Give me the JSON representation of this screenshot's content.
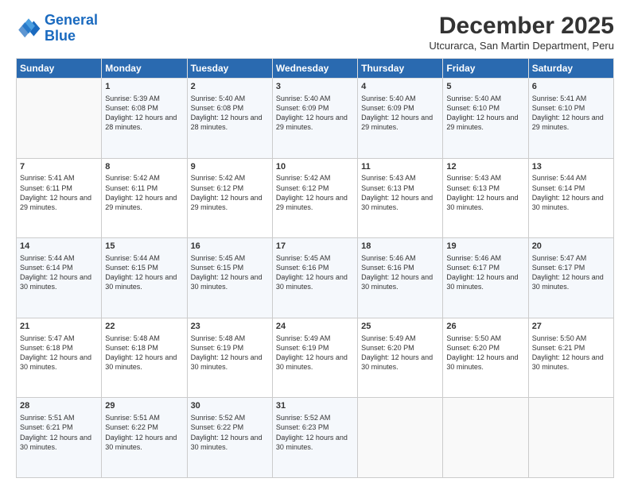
{
  "logo": {
    "line1": "General",
    "line2": "Blue"
  },
  "title": "December 2025",
  "location": "Utcurarca, San Martin Department, Peru",
  "days_of_week": [
    "Sunday",
    "Monday",
    "Tuesday",
    "Wednesday",
    "Thursday",
    "Friday",
    "Saturday"
  ],
  "weeks": [
    [
      {
        "num": "",
        "info": ""
      },
      {
        "num": "1",
        "info": "Sunrise: 5:39 AM\nSunset: 6:08 PM\nDaylight: 12 hours\nand 28 minutes."
      },
      {
        "num": "2",
        "info": "Sunrise: 5:40 AM\nSunset: 6:08 PM\nDaylight: 12 hours\nand 28 minutes."
      },
      {
        "num": "3",
        "info": "Sunrise: 5:40 AM\nSunset: 6:09 PM\nDaylight: 12 hours\nand 29 minutes."
      },
      {
        "num": "4",
        "info": "Sunrise: 5:40 AM\nSunset: 6:09 PM\nDaylight: 12 hours\nand 29 minutes."
      },
      {
        "num": "5",
        "info": "Sunrise: 5:40 AM\nSunset: 6:10 PM\nDaylight: 12 hours\nand 29 minutes."
      },
      {
        "num": "6",
        "info": "Sunrise: 5:41 AM\nSunset: 6:10 PM\nDaylight: 12 hours\nand 29 minutes."
      }
    ],
    [
      {
        "num": "7",
        "info": "Sunrise: 5:41 AM\nSunset: 6:11 PM\nDaylight: 12 hours\nand 29 minutes."
      },
      {
        "num": "8",
        "info": "Sunrise: 5:42 AM\nSunset: 6:11 PM\nDaylight: 12 hours\nand 29 minutes."
      },
      {
        "num": "9",
        "info": "Sunrise: 5:42 AM\nSunset: 6:12 PM\nDaylight: 12 hours\nand 29 minutes."
      },
      {
        "num": "10",
        "info": "Sunrise: 5:42 AM\nSunset: 6:12 PM\nDaylight: 12 hours\nand 29 minutes."
      },
      {
        "num": "11",
        "info": "Sunrise: 5:43 AM\nSunset: 6:13 PM\nDaylight: 12 hours\nand 30 minutes."
      },
      {
        "num": "12",
        "info": "Sunrise: 5:43 AM\nSunset: 6:13 PM\nDaylight: 12 hours\nand 30 minutes."
      },
      {
        "num": "13",
        "info": "Sunrise: 5:44 AM\nSunset: 6:14 PM\nDaylight: 12 hours\nand 30 minutes."
      }
    ],
    [
      {
        "num": "14",
        "info": "Sunrise: 5:44 AM\nSunset: 6:14 PM\nDaylight: 12 hours\nand 30 minutes."
      },
      {
        "num": "15",
        "info": "Sunrise: 5:44 AM\nSunset: 6:15 PM\nDaylight: 12 hours\nand 30 minutes."
      },
      {
        "num": "16",
        "info": "Sunrise: 5:45 AM\nSunset: 6:15 PM\nDaylight: 12 hours\nand 30 minutes."
      },
      {
        "num": "17",
        "info": "Sunrise: 5:45 AM\nSunset: 6:16 PM\nDaylight: 12 hours\nand 30 minutes."
      },
      {
        "num": "18",
        "info": "Sunrise: 5:46 AM\nSunset: 6:16 PM\nDaylight: 12 hours\nand 30 minutes."
      },
      {
        "num": "19",
        "info": "Sunrise: 5:46 AM\nSunset: 6:17 PM\nDaylight: 12 hours\nand 30 minutes."
      },
      {
        "num": "20",
        "info": "Sunrise: 5:47 AM\nSunset: 6:17 PM\nDaylight: 12 hours\nand 30 minutes."
      }
    ],
    [
      {
        "num": "21",
        "info": "Sunrise: 5:47 AM\nSunset: 6:18 PM\nDaylight: 12 hours\nand 30 minutes."
      },
      {
        "num": "22",
        "info": "Sunrise: 5:48 AM\nSunset: 6:18 PM\nDaylight: 12 hours\nand 30 minutes."
      },
      {
        "num": "23",
        "info": "Sunrise: 5:48 AM\nSunset: 6:19 PM\nDaylight: 12 hours\nand 30 minutes."
      },
      {
        "num": "24",
        "info": "Sunrise: 5:49 AM\nSunset: 6:19 PM\nDaylight: 12 hours\nand 30 minutes."
      },
      {
        "num": "25",
        "info": "Sunrise: 5:49 AM\nSunset: 6:20 PM\nDaylight: 12 hours\nand 30 minutes."
      },
      {
        "num": "26",
        "info": "Sunrise: 5:50 AM\nSunset: 6:20 PM\nDaylight: 12 hours\nand 30 minutes."
      },
      {
        "num": "27",
        "info": "Sunrise: 5:50 AM\nSunset: 6:21 PM\nDaylight: 12 hours\nand 30 minutes."
      }
    ],
    [
      {
        "num": "28",
        "info": "Sunrise: 5:51 AM\nSunset: 6:21 PM\nDaylight: 12 hours\nand 30 minutes."
      },
      {
        "num": "29",
        "info": "Sunrise: 5:51 AM\nSunset: 6:22 PM\nDaylight: 12 hours\nand 30 minutes."
      },
      {
        "num": "30",
        "info": "Sunrise: 5:52 AM\nSunset: 6:22 PM\nDaylight: 12 hours\nand 30 minutes."
      },
      {
        "num": "31",
        "info": "Sunrise: 5:52 AM\nSunset: 6:23 PM\nDaylight: 12 hours\nand 30 minutes."
      },
      {
        "num": "",
        "info": ""
      },
      {
        "num": "",
        "info": ""
      },
      {
        "num": "",
        "info": ""
      }
    ]
  ]
}
